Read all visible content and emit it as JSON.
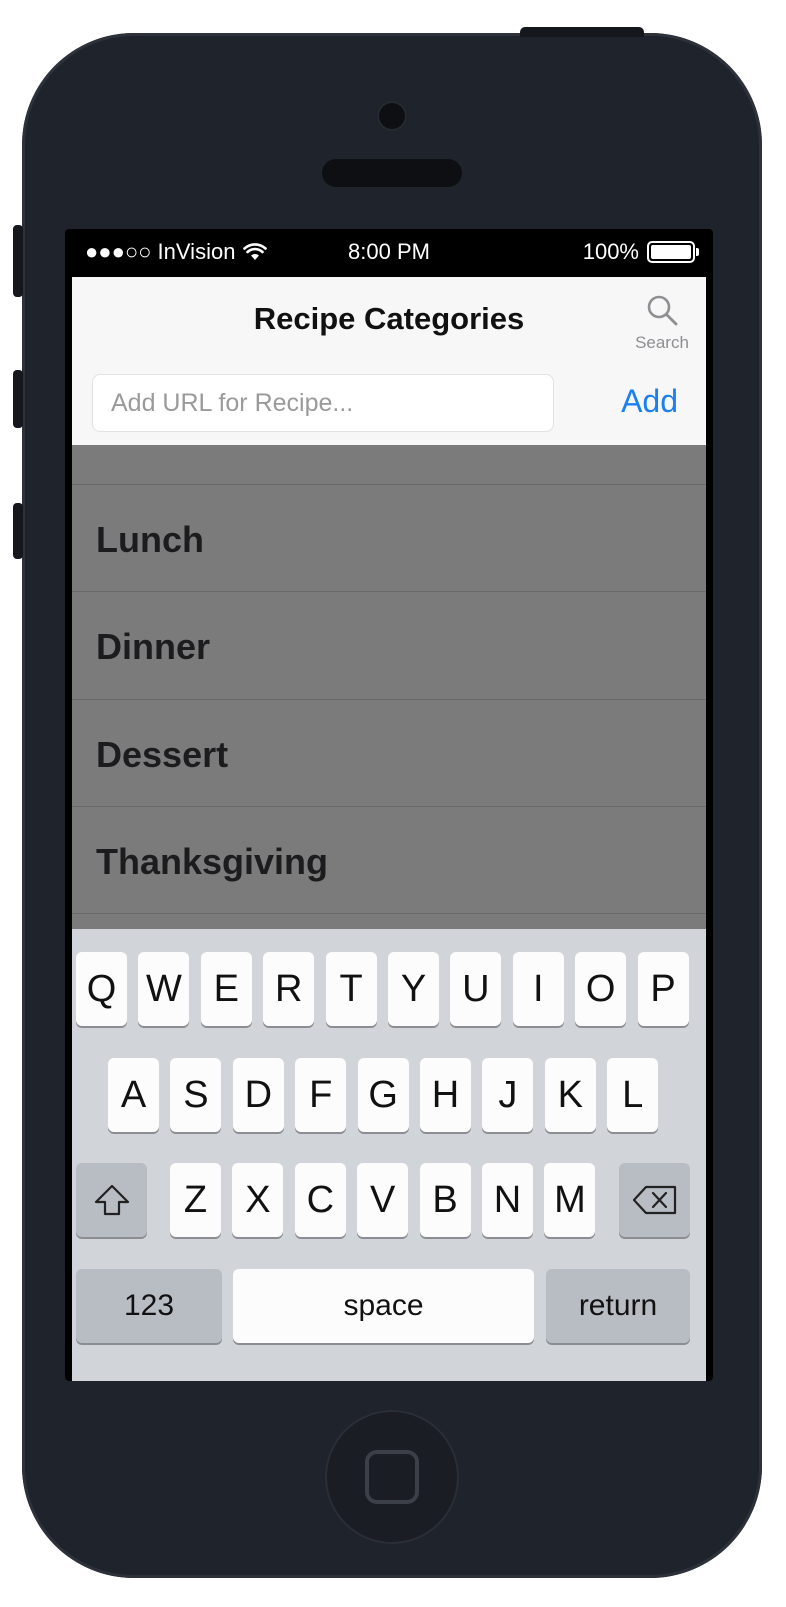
{
  "status_bar": {
    "carrier": "●●●○○ InVision",
    "time": "8:00 PM",
    "battery": "100%"
  },
  "nav": {
    "title": "Recipe Categories",
    "search_label": "Search"
  },
  "url_bar": {
    "placeholder": "Add URL for Recipe...",
    "add_label": "Add"
  },
  "categories": [
    {
      "label": ""
    },
    {
      "label": "Lunch"
    },
    {
      "label": "Dinner"
    },
    {
      "label": "Dessert"
    },
    {
      "label": "Thanksgiving"
    }
  ],
  "keyboard": {
    "row1": [
      "Q",
      "W",
      "E",
      "R",
      "T",
      "Y",
      "U",
      "I",
      "O",
      "P"
    ],
    "row2": [
      "A",
      "S",
      "D",
      "F",
      "G",
      "H",
      "J",
      "K",
      "L"
    ],
    "row3": [
      "Z",
      "X",
      "C",
      "V",
      "B",
      "N",
      "M"
    ],
    "numbers_label": "123",
    "space_label": "space",
    "return_label": "return",
    "shift_icon": "shift-icon",
    "delete_icon": "delete-icon"
  },
  "colors": {
    "accent": "#1a7ff0",
    "phone_body": "#1f232b",
    "overlay": "#7c7b7c"
  }
}
